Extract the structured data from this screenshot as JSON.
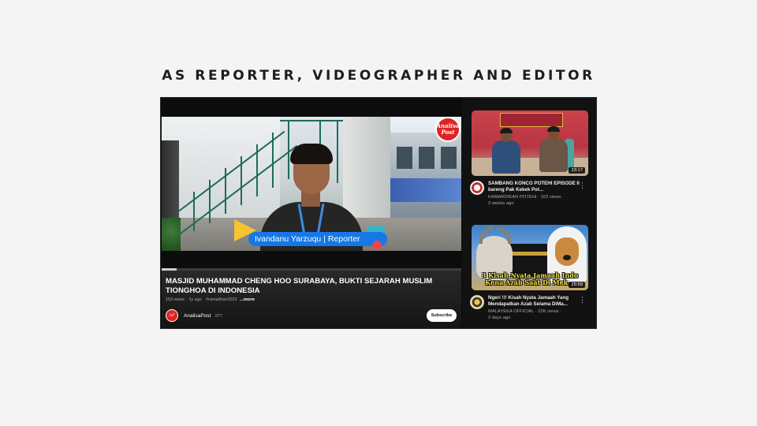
{
  "heading": "AS REPORTER, VIDEOGRAPHER AND EDITOR",
  "player": {
    "watermark": "Analisa Post",
    "lower_third_text": "Ivandanu Yarzuqu | Reporter",
    "progress_fraction": 0.05
  },
  "video": {
    "title": "MASJID MUHAMMAD CHENG HOO SURABAYA, BUKTI SEJARAH MUSLIM TIONGHOA DI INDONESIA",
    "views": "153 views",
    "age": "1y ago",
    "hashtag": "#ramadhan2023",
    "more_label": "...more",
    "channel_name": "AnalisaPost",
    "subscribers": "877",
    "subscribe_label": "Subscribe"
  },
  "recommendations": [
    {
      "title": "SAMBANG KONCO POTEHI EPISODE II bareng Pak Kekek Pot...",
      "channel_views": "KAMARDIKAN POTEHI · 163 views ·",
      "age": "3 weeks ago",
      "duration": "23:17"
    },
    {
      "title": "Ngeri !!! Kisah Nyata Jamaah Yang Mendapatkan Azab Selama DiMa...",
      "channel_views": "MALAYEKA OFFICIAL · 22K views ·",
      "age": "2 days ago",
      "duration": "25:59",
      "thumb_caption_1": "3 Kisah Nyata Jamaah Indo",
      "thumb_caption_2": "Kena Azab Saat Di Mek..."
    }
  ],
  "colors": {
    "page_background": "#f5f4f4",
    "youtube_dark": "#0f0f0f",
    "subscribe_button": "#ffffff",
    "lower_third_blue": "#1677e6",
    "lower_third_yellow": "#f4c431"
  }
}
